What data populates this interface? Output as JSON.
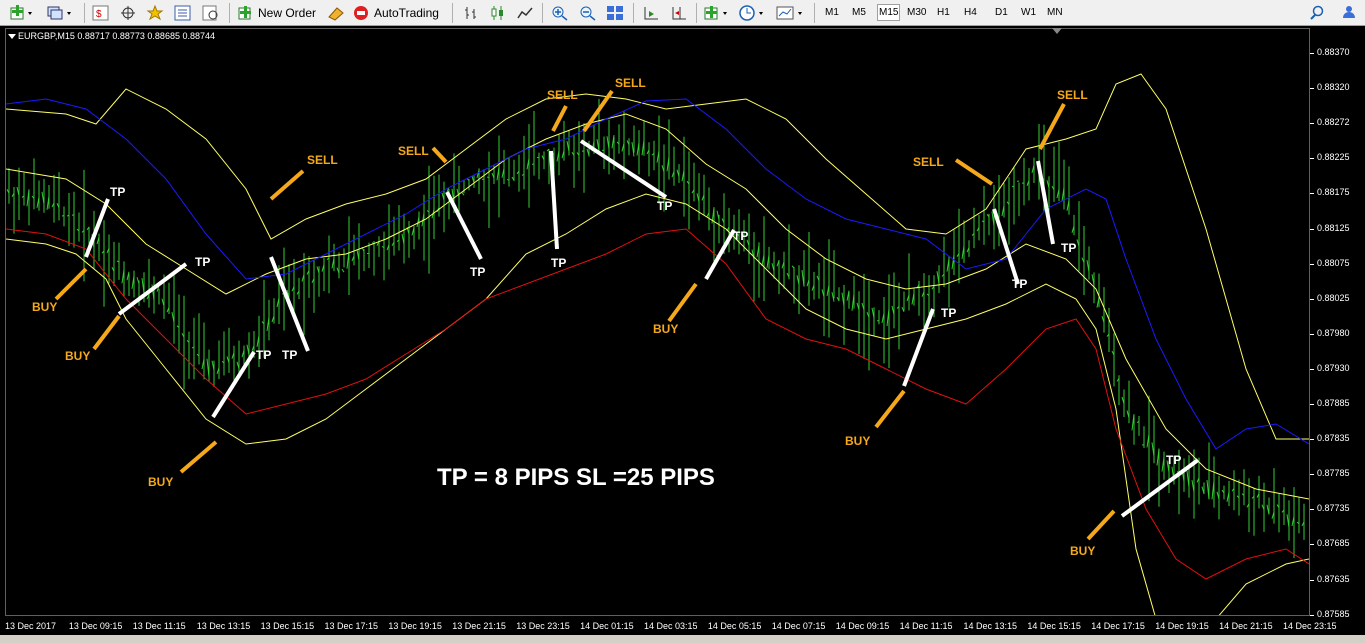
{
  "toolbar": {
    "new_order_label": "New Order",
    "autotrading_label": "AutoTrading",
    "timeframes": [
      "M1",
      "M5",
      "M15",
      "M30",
      "H1",
      "H4",
      "D1",
      "W1",
      "MN"
    ],
    "selected_timeframe": "M15"
  },
  "chart": {
    "info": "EURGBP,M15  0.88717 0.88773 0.88685 0.88744",
    "colors": {
      "background": "#000000",
      "candle": "#33cc33",
      "upper_band": "#ffff66",
      "lower_band": "#ffff66",
      "blue_line": "#1a1aff",
      "red_line": "#e01010",
      "trade_line": "#ffffff",
      "signal_line": "#f4a81a"
    },
    "y_labels": [
      "0.88370",
      "0.88320",
      "0.88272",
      "0.88225",
      "0.88175",
      "0.88125",
      "0.88075",
      "0.88025",
      "0.87980",
      "0.87930",
      "0.87885",
      "0.87835",
      "0.87785",
      "0.87735",
      "0.87685",
      "0.87635",
      "0.87585"
    ],
    "x_labels": [
      "13 Dec 2017",
      "13 Dec 09:15",
      "13 Dec 11:15",
      "13 Dec 13:15",
      "13 Dec 15:15",
      "13 Dec 17:15",
      "13 Dec 19:15",
      "13 Dec 21:15",
      "13 Dec 23:15",
      "14 Dec 01:15",
      "14 Dec 03:15",
      "14 Dec 05:15",
      "14 Dec 07:15",
      "14 Dec 09:15",
      "14 Dec 11:15",
      "14 Dec 13:15",
      "14 Dec 15:15",
      "14 Dec 17:15",
      "14 Dec 19:15",
      "14 Dec 21:15",
      "14 Dec 23:15"
    ],
    "annotations": [
      "BUY",
      "TP",
      "BUY",
      "TP",
      "BUY",
      "TP",
      "SELL",
      "TP",
      "SELL",
      "TP",
      "SELL",
      "TP",
      "SELL",
      "TP",
      "BUY",
      "TP",
      "BUY",
      "TP",
      "SELL",
      "TP",
      "SELL",
      "TP",
      "BUY",
      "TP"
    ],
    "rule_text": "TP = 8 PIPS   SL =25 PIPS"
  }
}
